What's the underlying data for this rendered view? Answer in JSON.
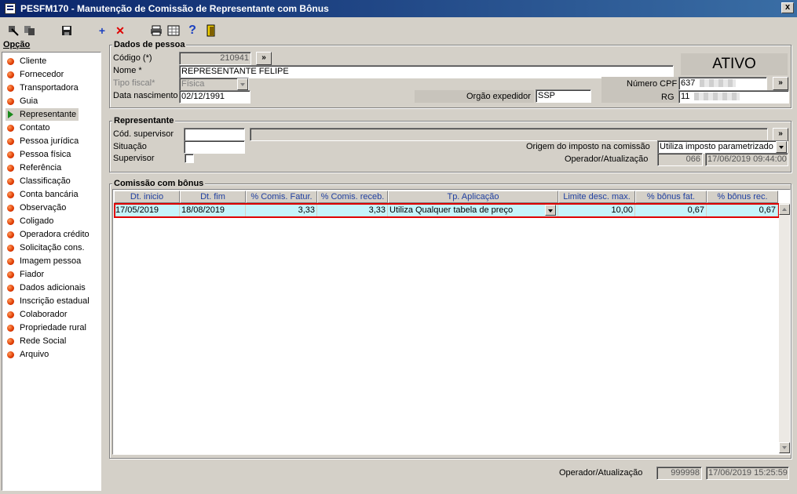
{
  "window": {
    "title": "PESFM170 - Manutenção de Comissão de Representante com Bônus",
    "close_label": "x"
  },
  "toolbar": {
    "icons": [
      "cut-icon",
      "copy-icon",
      "save-icon",
      "add-icon",
      "delete-icon",
      "print-icon",
      "grid-icon",
      "help-icon",
      "exit-icon"
    ]
  },
  "sidebar": {
    "title": "Opção",
    "items": [
      {
        "label": "Cliente"
      },
      {
        "label": "Fornecedor"
      },
      {
        "label": "Transportadora"
      },
      {
        "label": "Guia"
      },
      {
        "label": "Representante",
        "selected": true
      },
      {
        "label": "Contato"
      },
      {
        "label": "Pessoa jurídica"
      },
      {
        "label": "Pessoa física"
      },
      {
        "label": "Referência"
      },
      {
        "label": "Classificação"
      },
      {
        "label": "Conta bancária"
      },
      {
        "label": "Observação"
      },
      {
        "label": "Coligado"
      },
      {
        "label": "Operadora crédito"
      },
      {
        "label": "Solicitação cons."
      },
      {
        "label": "Imagem pessoa"
      },
      {
        "label": "Fiador"
      },
      {
        "label": "Dados adicionais"
      },
      {
        "label": "Inscrição estadual"
      },
      {
        "label": "Colaborador"
      },
      {
        "label": "Propriedade rural"
      },
      {
        "label": "Rede Social"
      },
      {
        "label": "Arquivo"
      }
    ]
  },
  "dados_pessoa": {
    "title": "Dados de pessoa",
    "codigo_label": "Código (*)",
    "codigo_value": "210941",
    "lookup_label": "»",
    "nome_label": "Nome *",
    "nome_value": "REPRESENTANTE FELIPE",
    "tipo_fiscal_label": "Tipo fiscal*",
    "tipo_fiscal_value": "Física",
    "data_nasc_label": "Data nascimento",
    "data_nasc_value": "02/12/1991",
    "orgao_label": "Orgão expedidor",
    "orgao_value": "SSP",
    "status": "ATIVO",
    "cpf_label": "Número CPF",
    "cpf_value": "637",
    "rg_label": "RG",
    "rg_value": "11"
  },
  "representante": {
    "title": "Representante",
    "cod_supervisor_label": "Cód. supervisor",
    "situacao_label": "Situação",
    "supervisor_label": "Supervisor",
    "origem_label": "Origem do imposto na comissão",
    "origem_value": "Utiliza imposto parametrizado",
    "operador_label": "Operador/Atualização",
    "operador_value": "066",
    "atualizacao_value": "17/06/2019 09:44:00"
  },
  "comissao": {
    "title": "Comissão com bônus",
    "columns": [
      "Dt. inicio",
      "Dt. fim",
      "% Comis. Fatur.",
      "% Comis. receb.",
      "Tp. Aplicação",
      "Limite desc. max.",
      "% bônus fat.",
      "% bônus rec."
    ],
    "rows": [
      [
        "17/05/2019",
        "18/08/2019",
        "3,33",
        "3,33",
        "Utiliza Qualquer tabela de preço",
        "10,00",
        "0,67",
        "0,67"
      ]
    ]
  },
  "footer": {
    "operador_label": "Operador/Atualização",
    "operador_value": "999998",
    "atualizacao_value": "17/06/2019 15:25:59"
  }
}
